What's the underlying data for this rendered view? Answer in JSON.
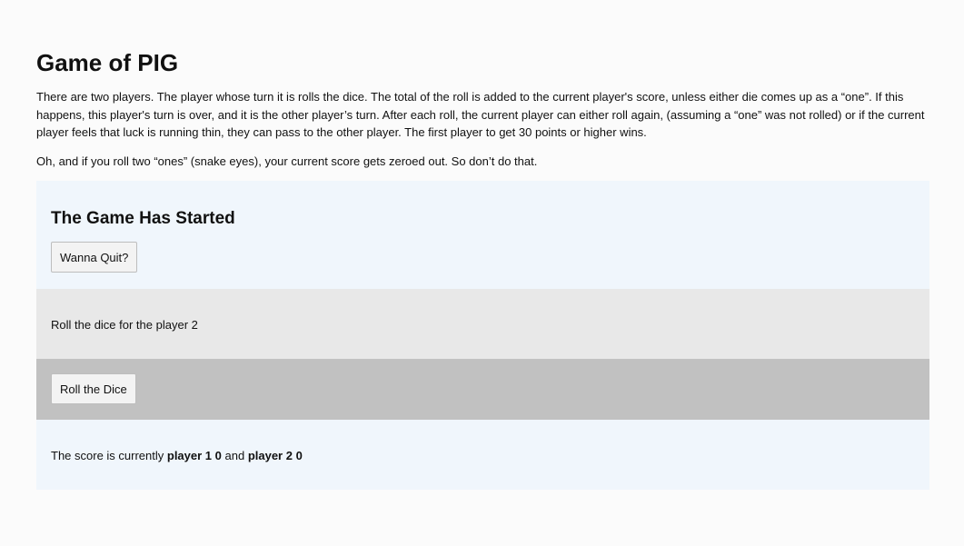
{
  "page": {
    "title": "Game of PIG",
    "intro": "There are two players. The player whose turn it is rolls the dice. The total of the roll is added to the current player's score, unless either die comes up as a “one”. If this happens, this player's turn is over, and it is the other player’s turn. After each roll, the current player can either roll again, (assuming a “one” was not rolled) or if the current player feels that luck is running thin, they can pass to the other player. The first player to get 30 points or higher wins.",
    "note": "Oh, and if you roll two “ones” (snake eyes), your current score gets zeroed out. So don’t do that."
  },
  "game": {
    "status_heading": "The Game Has Started",
    "quit_label": "Wanna Quit?",
    "turn_text": "Roll the dice for the player 2",
    "roll_label": "Roll the Dice",
    "score": {
      "prefix": "The score is currently ",
      "player1_label": "player 1",
      "player1_score": "0",
      "joiner": " and ",
      "player2_label": "player 2",
      "player2_score": "0"
    }
  },
  "colors": {
    "start_panel_bg": "#f0f6fc",
    "turn_panel_bg": "#e8e8e8",
    "roll_panel_bg": "#c1c1c1",
    "score_panel_bg": "#f0f6fc"
  }
}
